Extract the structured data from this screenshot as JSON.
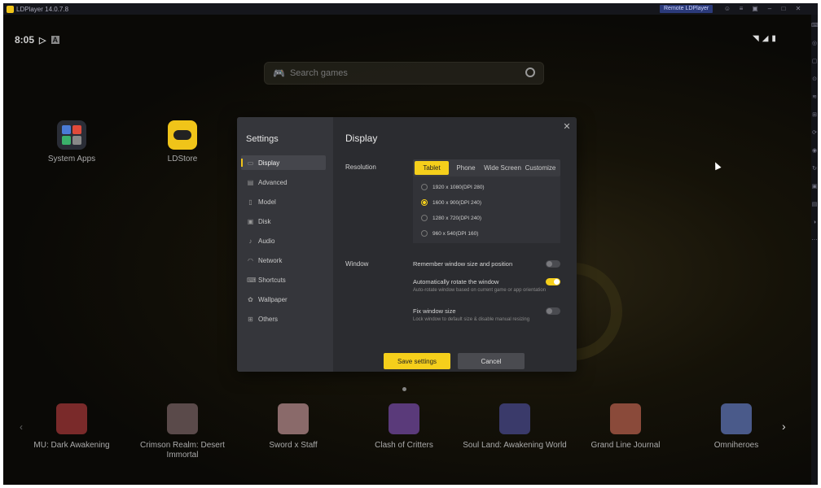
{
  "window": {
    "title": "LDPlayer 14.0.7.8",
    "remote_button": "Remote LDPlayer",
    "controls": [
      "user-icon",
      "menu-icon",
      "restore-icon",
      "minimize-icon",
      "maximize-icon",
      "close-icon"
    ]
  },
  "status_bar": {
    "time": "8:05",
    "icons": [
      "play-store-icon",
      "notification-icon",
      "wifi-icon",
      "signal-icon",
      "battery-icon"
    ]
  },
  "search": {
    "placeholder": "Search games"
  },
  "desktop_apps": [
    {
      "label": "System Apps",
      "icon": "system-apps-icon"
    },
    {
      "label": "LDStore",
      "icon": "ldstore-icon"
    }
  ],
  "settings": {
    "title": "Settings",
    "close_icon": "close-icon",
    "nav": [
      {
        "label": "Display",
        "icon": "display-icon",
        "active": true
      },
      {
        "label": "Advanced",
        "icon": "advanced-icon"
      },
      {
        "label": "Model",
        "icon": "model-icon"
      },
      {
        "label": "Disk",
        "icon": "disk-icon"
      },
      {
        "label": "Audio",
        "icon": "audio-icon"
      },
      {
        "label": "Network",
        "icon": "network-icon"
      },
      {
        "label": "Shortcuts",
        "icon": "shortcuts-icon"
      },
      {
        "label": "Wallpaper",
        "icon": "wallpaper-icon"
      },
      {
        "label": "Others",
        "icon": "others-icon"
      }
    ],
    "display": {
      "title": "Display",
      "resolution_label": "Resolution",
      "tabs": [
        {
          "label": "Tablet",
          "active": true
        },
        {
          "label": "Phone"
        },
        {
          "label": "Wide Screen"
        },
        {
          "label": "Customize"
        }
      ],
      "options": [
        {
          "label": "1920 x 1080(DPI 280)",
          "selected": false
        },
        {
          "label": "1600 x 900(DPI 240)",
          "selected": true
        },
        {
          "label": "1280 x 720(DPI 240)",
          "selected": false
        },
        {
          "label": "960 x 540(DPI 160)",
          "selected": false
        }
      ],
      "window_label": "Window",
      "window_options": [
        {
          "label": "Remember window size and position",
          "sub": "",
          "on": false
        },
        {
          "label": "Automatically rotate the window",
          "sub": "Auto-rotate window based on current game or app orientation",
          "on": true
        },
        {
          "label": "Fix window size",
          "sub": "Lock window to default size & disable manual resizing",
          "on": false
        }
      ]
    },
    "save_label": "Save settings",
    "cancel_label": "Cancel"
  },
  "games": [
    {
      "label": "MU: Dark Awakening",
      "color": "#7a2a2a"
    },
    {
      "label": "Crimson Realm: Desert Immortal",
      "color": "#5a4a4a"
    },
    {
      "label": "Sword x Staff",
      "color": "#8a6a6a"
    },
    {
      "label": "Clash of Critters",
      "color": "#5a3a7a"
    },
    {
      "label": "Soul Land: Awakening World",
      "color": "#3a3a6a"
    },
    {
      "label": "Grand Line Journal",
      "color": "#8a4a3a"
    },
    {
      "label": "Omniheroes",
      "color": "#4a5a8a"
    }
  ],
  "colors": {
    "accent": "#f5cf1b",
    "dialog_bg": "#2b2c30",
    "sidebar_bg": "#35363b"
  }
}
